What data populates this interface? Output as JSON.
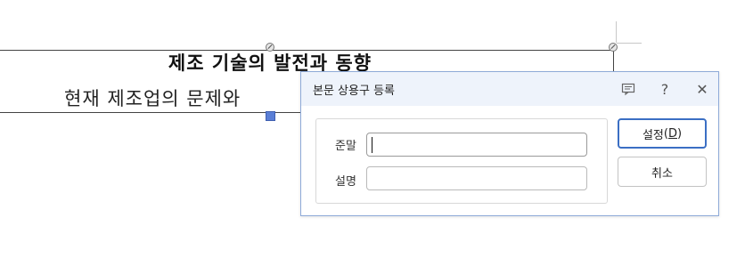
{
  "document": {
    "title": "제조 기술의 발전과 동향",
    "body_line": "현재 제조업의 문제와"
  },
  "dialog": {
    "title": "본문 상용구 등록",
    "icons": {
      "comment": "comment-icon",
      "help": "help-icon",
      "close": "close-icon"
    },
    "help_glyph": "?",
    "close_glyph": "✕",
    "fields": [
      {
        "label": "준말",
        "value": ""
      },
      {
        "label": "설명",
        "value": ""
      }
    ],
    "buttons": {
      "confirm_label": "설정",
      "confirm_key": "D",
      "cancel_label": "취소"
    }
  },
  "colors": {
    "titlebar_bg": "#eef3fb",
    "dialog_border": "#8eaad8",
    "primary_button_border": "#3b6fc4",
    "selection_handle": "#5b7fd6"
  }
}
